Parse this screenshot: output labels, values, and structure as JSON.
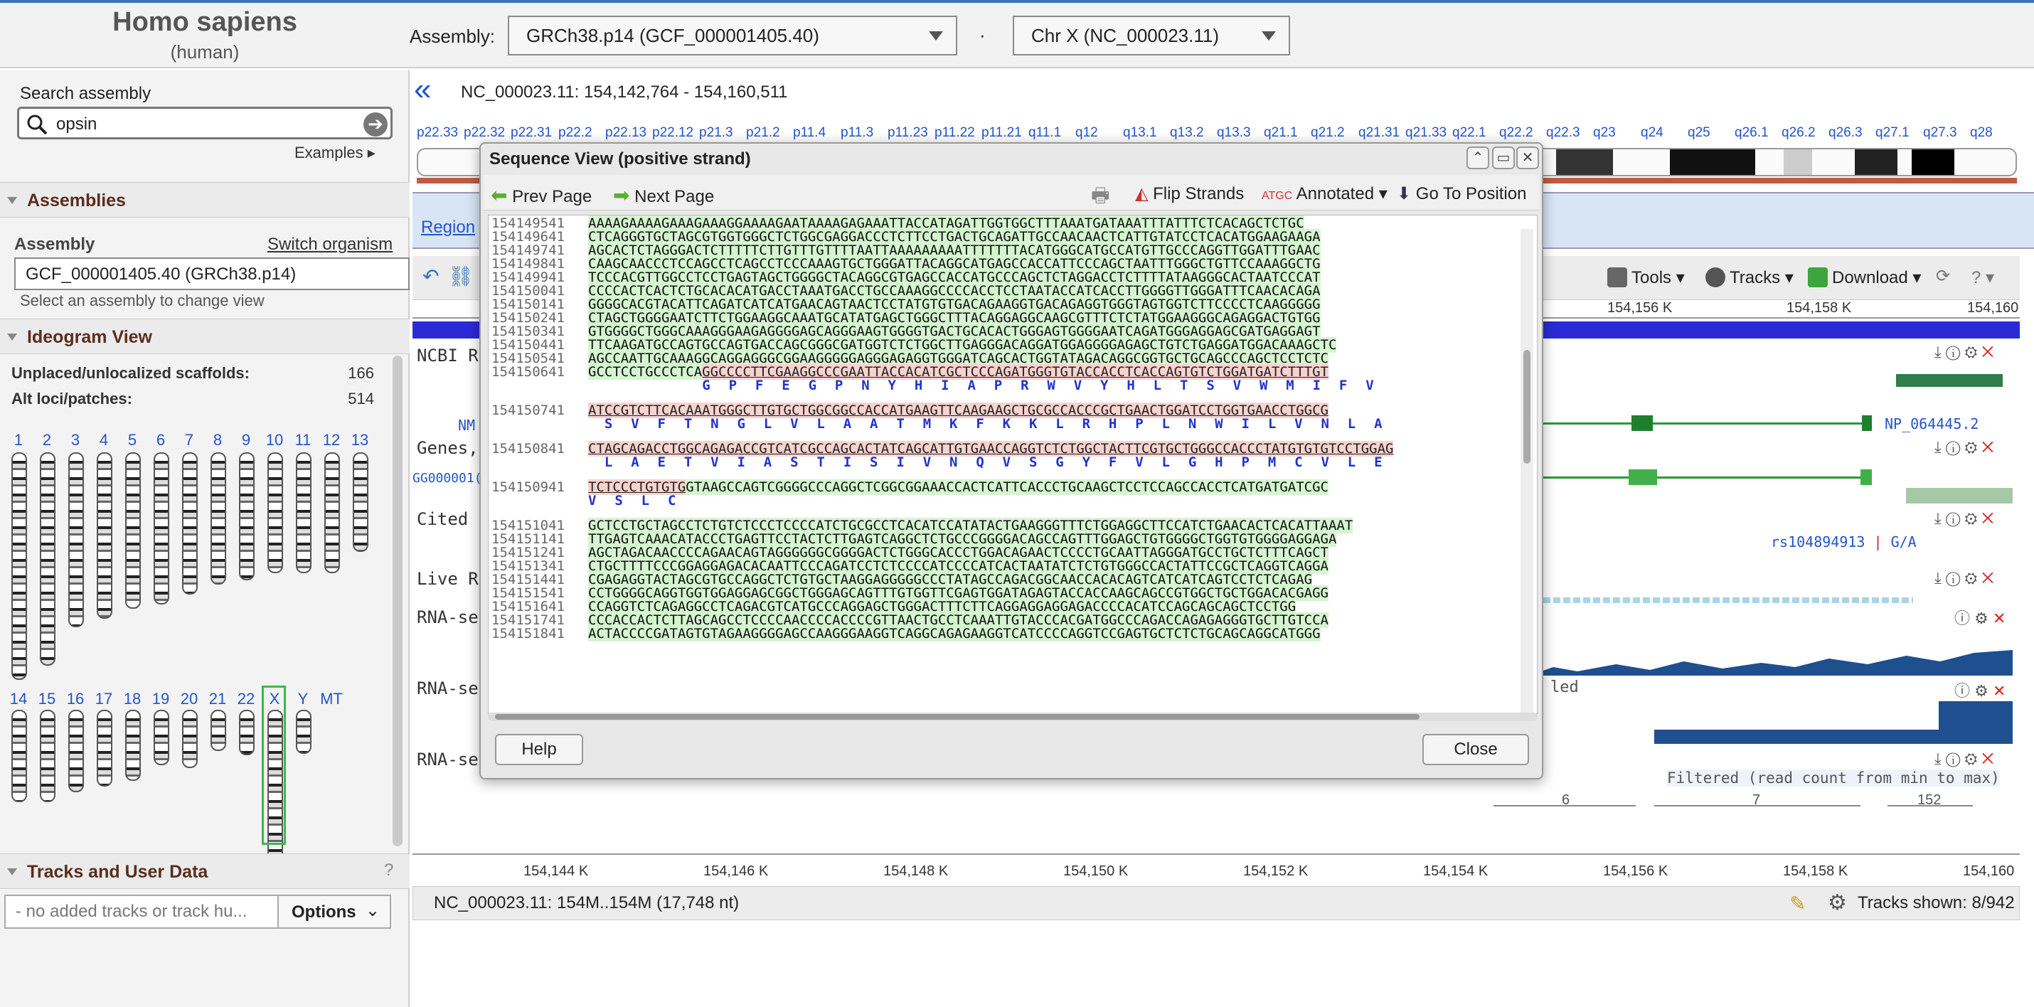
{
  "header": {
    "organism": "Homo sapiens",
    "common_name": "(human)",
    "assembly_label": "Assembly:",
    "assembly_value": "GRCh38.p14 (GCF_000001405.40)",
    "separator": "·",
    "chromosome_value": "Chr X (NC_000023.11)"
  },
  "sidebar": {
    "search_label": "Search assembly",
    "search_value": "opsin",
    "examples": "Examples ▸",
    "assemblies_title": "Assemblies",
    "assembly_field_label": "Assembly",
    "switch_organism": "Switch organism",
    "assembly_input": "GCF_000001405.40 (GRCh38.p14)",
    "assembly_hint": "Select an assembly to change view",
    "ideogram_title": "Ideogram View",
    "unplaced_label": "Unplaced/unlocalized scaffolds:",
    "unplaced_value": "166",
    "altloci_label": "Alt loci/patches:",
    "altloci_value": "514",
    "chromosomes_row1": [
      "1",
      "2",
      "3",
      "4",
      "5",
      "6",
      "7",
      "8",
      "9",
      "10",
      "11",
      "12",
      "13"
    ],
    "chromosomes_row2": [
      "14",
      "15",
      "16",
      "17",
      "18",
      "19",
      "20",
      "21",
      "22",
      "X",
      "Y",
      "MT"
    ],
    "tracks_title": "Tracks and User Data",
    "tracks_help": "?",
    "tracks_placeholder": "- no added tracks or track hu...",
    "options_label": "Options"
  },
  "main": {
    "nav_back": "«",
    "title": "NC_000023.11:  154,142,764 - 154,160,511",
    "bands": [
      "p22.33",
      "p22.32",
      "p22.31",
      "p22.2",
      "p22.13",
      "p22.12",
      "p21.3",
      "p21.2",
      "p11.4",
      "p11.3",
      "p11.23",
      "p11.22",
      "p11.21",
      "q11.1",
      "q12",
      "q13.1",
      "q13.2",
      "q13.3",
      "q21.1",
      "q21.2",
      "q21.31",
      "q21.33",
      "q22.1",
      "q22.2",
      "q22.3",
      "q23",
      "q24",
      "q25",
      "q26.1",
      "q26.2",
      "q26.3",
      "q27.1",
      "q27.3",
      "q28"
    ],
    "region_link": "Region",
    "toolbar": {
      "tools": "Tools ▾",
      "tracks": "Tracks ▾",
      "download": "Download ▾",
      "help": "? ▾"
    },
    "ruler_ticks": [
      "154,156 K",
      "154,158 K",
      "154,160"
    ],
    "track_labels": [
      "NCBI R",
      "Genes,",
      "Cited",
      "Live R",
      "RNA-se",
      "RNA-se",
      "RNA-se"
    ],
    "frag_nm": "NM",
    "frag_id": "GG000001(",
    "gene_label": "NP_064445.2",
    "variant_label": "rs104894913",
    "variant_alleles": "G/A",
    "rnaseq_frag": "led",
    "filtered_note": "Filtered (read count from min to max)",
    "exon_nums": [
      "6",
      "7",
      "152"
    ],
    "bottom_ticks": [
      "154,144 K",
      "154,146 K",
      "154,148 K",
      "154,150 K",
      "154,152 K",
      "154,154 K",
      "154,156 K",
      "154,158 K",
      "154,160"
    ],
    "status_left": "NC_000023.11: 154M..154M (17,748 nt)",
    "status_right": "Tracks shown: 8/942"
  },
  "dialog": {
    "title": "Sequence View (positive strand)",
    "prev": "Prev Page",
    "next": "Next Page",
    "flip": "Flip Strands",
    "annotated": "Annotated ▾",
    "goto": "Go To Position",
    "help": "Help",
    "close": "Close",
    "rows": [
      {
        "pos": "154149541",
        "seq": "AAAAGAAAAGAAAGAAAGGAAAAGAATAAAAGAGAAATTACCATAGATTGGTGGCTTTAAATGATAAATTTATTTCTCACAGCTCTGC",
        "kind": "g"
      },
      {
        "pos": "154149641",
        "seq": "CTCAGGGTGCTAGCGTGGTGGGCTCTGGCGAGGACCCTCTTCCTGACTGCAGATTGCCAACAACTCATTGTATCCTCACATGGAAGAAGA",
        "kind": "g"
      },
      {
        "pos": "154149741",
        "seq": "AGCACTCTAGGGACTCTTTTTCTTGTTTGTTTTAATTAAAAAAAAATTTTTTTACATGGGCATGCCATGTTGCCCAGGTTGGATTTGAAC",
        "kind": "g"
      },
      {
        "pos": "154149841",
        "seq": "CAAGCAACCCTCCAGCCTCAGCCTCCCAAAGTGCTGGGATTACAGGCATGAGCCACCATTCCCAGCTAATTTGGGCTGTTCCAAAGGCTG",
        "kind": "g"
      },
      {
        "pos": "154149941",
        "seq": "TCCCACGTTGGCCTCCTGAGTAGCTGGGGCTACAGGCGTGAGCCACCATGCCCAGCTCTAGGACCTCTTTTATAAGGGCACTAATCCCAT",
        "kind": "g"
      },
      {
        "pos": "154150041",
        "seq": "CCCCACTCACTCTGCACACATGACCTAAATGACCTGCCAAAGGCCCCACCTCCTAATACCATCACCTTGGGGTTGGGATTTCAACACAGA",
        "kind": "g"
      },
      {
        "pos": "154150141",
        "seq": "GGGGCACGTACATTCAGATCATCATGAACAGTAACTCCTATGTGTGACAGAAGGTGACAGAGGTGGGTAGTGGTCTTCCCCTCAAGGGGG",
        "kind": "g"
      },
      {
        "pos": "154150241",
        "seq": "CTAGCTGGGGAATCTTCTGGAAGGCAAATGCATATGAGCTGGGCTTTACAGGAGGCAAGCGTTTCTCTATGGAAGGGCAGAGGACTGTGG",
        "kind": "g"
      },
      {
        "pos": "154150341",
        "seq": "GTGGGGCTGGGCAAAGGGAAGAGGGGAGCAGGGAAGTGGGGTGACTGCACACTGGGAGTGGGGAATCAGATGGGAGGAGCGATGAGGAGT",
        "kind": "g"
      },
      {
        "pos": "154150441",
        "seq": "TTCAAGATGCCAGTGCCAGTGACCAGCGGGCGATGGTCTCTGGCTTGAGGGACAGGATGGAGGGGAGAGCTGTCTGAGGATGGACAAAGCTC",
        "kind": "g"
      },
      {
        "pos": "154150541",
        "seq": "AGCCAATTGCAAAGGCAGGAGGGCGGAAGGGGGAGGGAGAGGTGGGATCAGCACTGGTATAGACAGGCGGTGCTGCAGCCCAGCTCCTCTC",
        "kind": "g"
      },
      {
        "pos": "154150641",
        "seq": "GCCTCCTGCCCTCAGGCCCCTTCGAAGGCCCGAATTACCACATCGCTCCCAGATGGGTGTACCACCTCACCAGTGTCTGGATGATCTTTGT",
        "kind": "gp",
        "split": 14,
        "aa": "G P F E G P N Y H I A P R W V Y H L T S V W M I F V",
        "aaoff": 14
      },
      {
        "pos": "154150741",
        "seq": "ATCCGTCTTCACAAATGGGCTTGTGCTGGCGGCCACCATGAAGTTCAAGAAGCTGCGCCACCCGCTGAACTGGATCCTGGTGAACCTGGCG",
        "kind": "p",
        "aa": "S V F T N G L V L A A T M K F K K L R H P L N W I L V N L A",
        "aaoff": 2
      },
      {
        "pos": "154150841",
        "seq": "CTAGCAGACCTGGCAGAGACCGTCATCGCCAGCACTATCAGCATTGTGAACCAGGTCTCTGGCTACTTCGTGCTGGGCCACCCTATGTGTGTCCTGGAG",
        "kind": "p",
        "aa": "L A E T V I A S T I S I V N Q V S G Y F V L G H P M C V L E",
        "aaoff": 2
      },
      {
        "pos": "154150941",
        "seq": "TCTCCCTGTGTGGTAAGCCAGTCGGGGCCCAGGCTCGGCGGAAACCACTCATTCACCCTGCAAGCTCCTCCAGCCACCTCATGATGATCGC",
        "kind": "pg",
        "split": 12,
        "aa": "V S L C",
        "aaoff": 0
      },
      {
        "pos": "154151041",
        "seq": "GCTCCTGCTAGCCTCTGTCTCCCTCCCCATCTGCGCCTCACATCCATATACTGAAGGGTTTCTGGAGGCTTCCATCTGAACACTCACATTAAAT",
        "kind": "g"
      },
      {
        "pos": "154151141",
        "seq": "TTGAGTCAAACATACCCTGAGTTCCTACTCTTGAGTCAGGCTCTGCCCGGGGACAGCCAGTTTGGAGCTGTGGGGCTGGTGTGGGGAGGAGA",
        "kind": "g"
      },
      {
        "pos": "154151241",
        "seq": "AGCTAGACAACCCCAGAACAGTAGGGGGGCGGGGACTCTGGGCACCCTGGACAGAACTCCCCTGCAATTAGGGATGCCTGCTCTTTCAGCT",
        "kind": "g"
      },
      {
        "pos": "154151341",
        "seq": "CTGCTTTTCCCGGAGGAGACACAATTCCCAGATCCTCTCCCCATCCCCATCACTAATATCTCTGTGGGCCACTATTCCGCTCAGGTCAGGA",
        "kind": "g"
      },
      {
        "pos": "154151441",
        "seq": "CGAGAGGTACTAGCGTGCCAGGCTCTGTGCTAAGGAGGGGGCCCTATAGCCAGACGGCAACCACACAGTCATCATCAGTCCTCTCAGAG",
        "kind": "g"
      },
      {
        "pos": "154151541",
        "seq": "CCTGGGGCAGGTGGTGGAGGAGCGGCTGGGAGCAGTTTGTGGTTCGAGTGGATAGAGTACCACCAAGCAGCCGTGGCTGCTGGACACGAGG",
        "kind": "g"
      },
      {
        "pos": "154151641",
        "seq": "CCAGGTCTCAGAGGCCTCAGACGTCATGCCCAGGAGCTGGGACTTTCTTCAGGAGGAGGAGACCCCACATCCAGCAGCAGCTCCTGG",
        "kind": "g"
      },
      {
        "pos": "154151741",
        "seq": "CCCACCACTCTTAGCAGCCTCCCCAACCCCACCCCGTTAACTGCCTCAAATTGTACCCACGATGGCCCAGACCAGAGAGGGTGCTTGTCCA",
        "kind": "g"
      },
      {
        "pos": "154151841",
        "seq": "ACTACCCCGATAGTGTAGAAGGGGAGCCAAGGGAAGGTCAGGCAGAGAAGGTCATCCCCAGGTCCGAGTGCTCTCTGCAGCAGGCATGGG",
        "kind": "g"
      }
    ]
  }
}
